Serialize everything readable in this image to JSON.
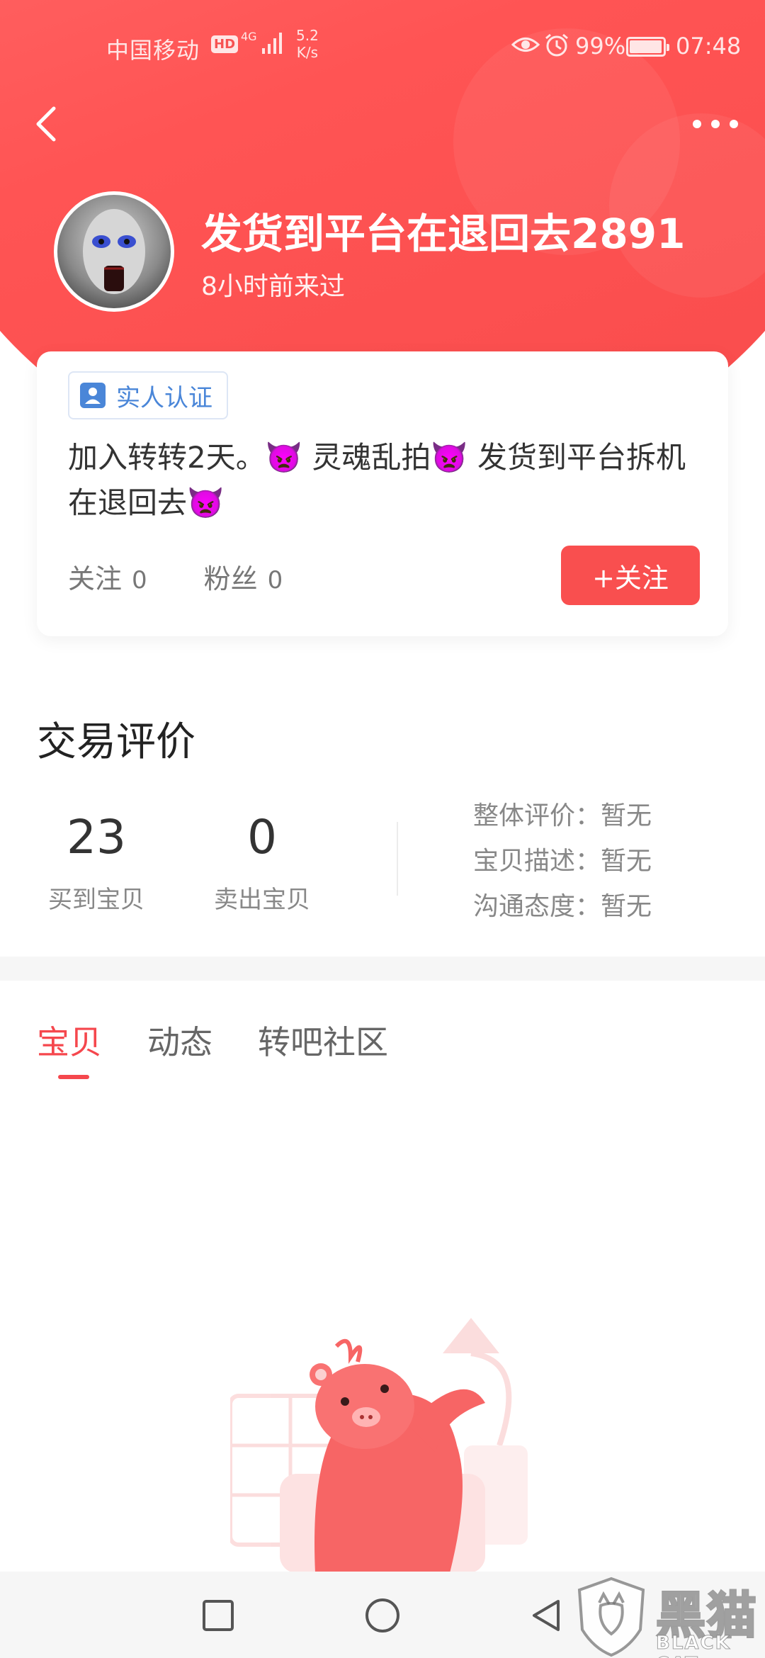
{
  "status_bar": {
    "carrier": "中国移动",
    "hd": "HD",
    "network": "4G",
    "speed_value": "5.2",
    "speed_unit": "K/s",
    "battery_pct": "99%",
    "time": "07:48"
  },
  "profile": {
    "name": "发货到平台在退回去2891",
    "last_seen": "8小时前来过",
    "verify_label": "实人认证",
    "bio": "加入转转2天。👿 灵魂乱拍👿 发货到平台拆机在退回去👿",
    "following_label": "关注",
    "following_count": "0",
    "fans_label": "粉丝",
    "fans_count": "0",
    "follow_button": "+关注"
  },
  "trade_review": {
    "title": "交易评价",
    "bought_count": "23",
    "bought_label": "买到宝贝",
    "sold_count": "0",
    "sold_label": "卖出宝贝",
    "ratings": [
      {
        "label": "整体评价：",
        "value": "暂无"
      },
      {
        "label": "宝贝描述：",
        "value": "暂无"
      },
      {
        "label": "沟通态度：",
        "value": "暂无"
      }
    ]
  },
  "tabs": [
    {
      "label": "宝贝",
      "active": true
    },
    {
      "label": "动态",
      "active": false
    },
    {
      "label": "转吧社区",
      "active": false
    }
  ],
  "watermark": {
    "cn": "黑猫",
    "en": "BLACK CAT"
  },
  "colors": {
    "brand_red": "#f94f4f",
    "tab_active": "#f5474d",
    "verify_blue": "#4a86d8"
  },
  "icons": {
    "back": "chevron-left-icon",
    "more": "more-dots-icon",
    "verify": "person-badge-icon",
    "nav_recent": "square-icon",
    "nav_home": "circle-icon",
    "nav_back": "triangle-back-icon"
  }
}
